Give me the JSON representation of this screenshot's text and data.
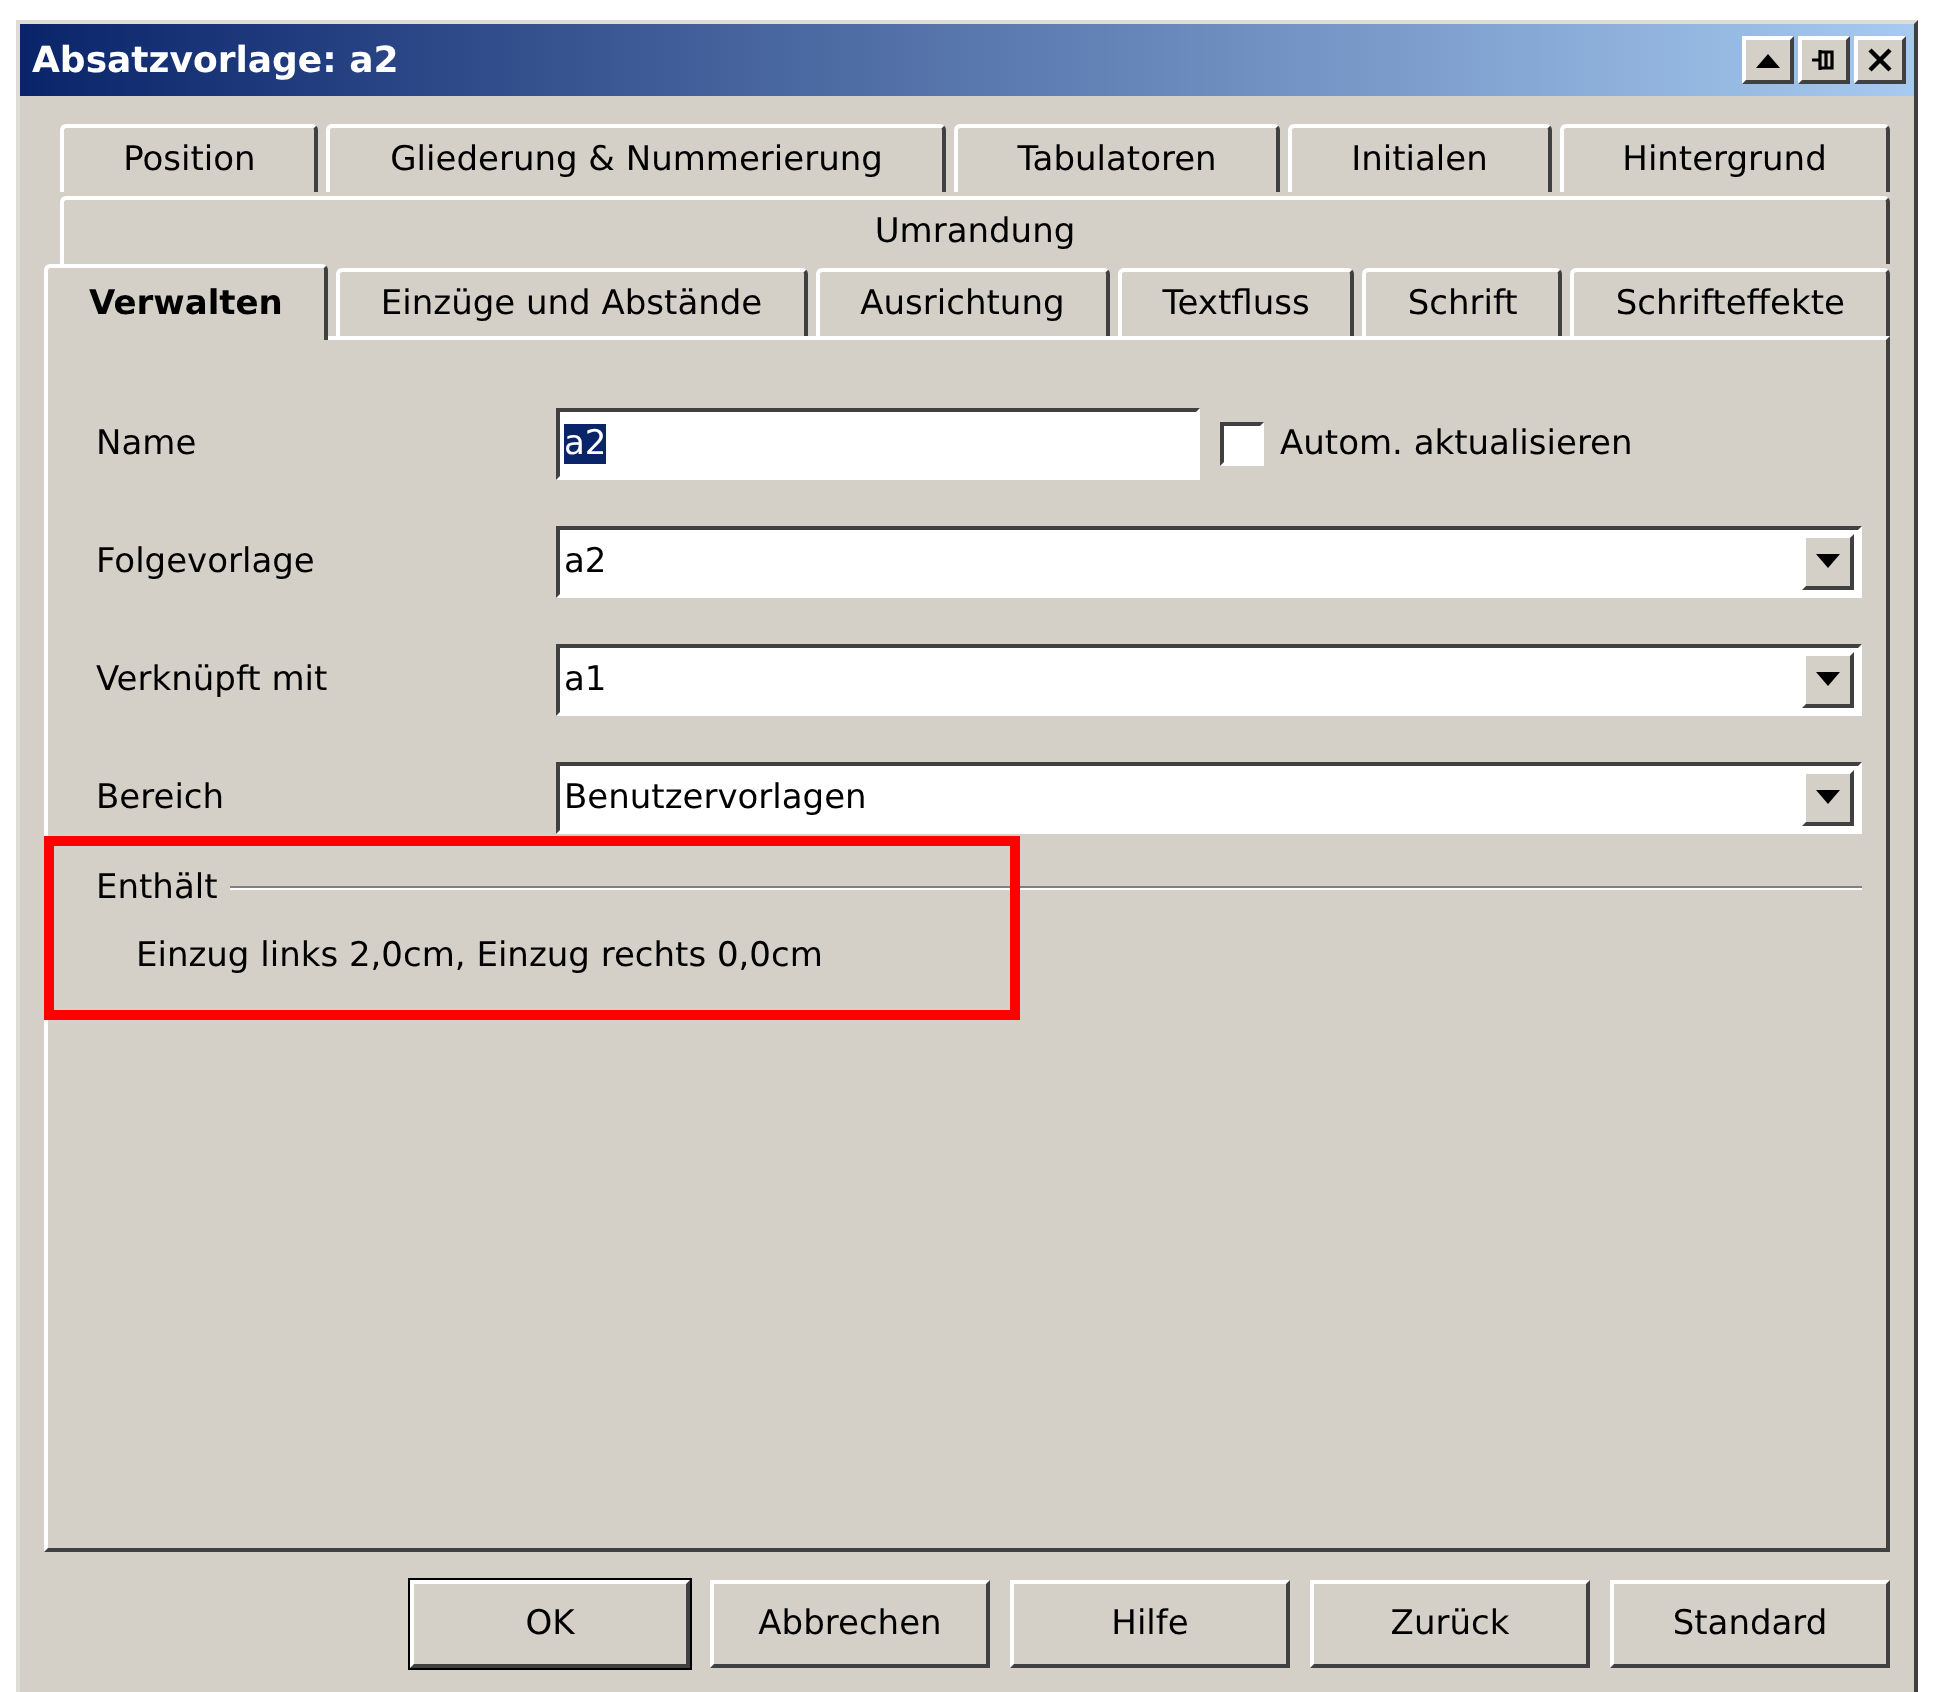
{
  "window": {
    "title": "Absatzvorlage: a2",
    "controls": [
      {
        "kind": "rollup"
      },
      {
        "kind": "pin"
      },
      {
        "kind": "close"
      }
    ]
  },
  "tab_rows": [
    [
      {
        "label": "Position",
        "selected": false
      },
      {
        "label": "Gliederung & Nummerierung",
        "selected": false
      },
      {
        "label": "Tabulatoren",
        "selected": false
      },
      {
        "label": "Initialen",
        "selected": false
      },
      {
        "label": "Hintergrund",
        "selected": false
      }
    ],
    [
      {
        "label": "Umrandung",
        "selected": false
      }
    ],
    [
      {
        "label": "Verwalten",
        "selected": true
      },
      {
        "label": "Einzüge und Abstände",
        "selected": false
      },
      {
        "label": "Ausrichtung",
        "selected": false
      },
      {
        "label": "Textfluss",
        "selected": false
      },
      {
        "label": "Schrift",
        "selected": false
      },
      {
        "label": "Schrifteffekte",
        "selected": false
      }
    ]
  ],
  "form": [
    {
      "kind": "text",
      "label": "Name",
      "value": "a2",
      "checkbox": {
        "label": "Autom. aktualisieren",
        "checked": false
      }
    },
    {
      "kind": "combo",
      "label": "Folgevorlage",
      "value": "a2"
    },
    {
      "kind": "combo",
      "label": "Verknüpft mit",
      "value": "a1"
    },
    {
      "kind": "combo",
      "label": "Bereich",
      "value": "Benutzervorlagen"
    }
  ],
  "contains": {
    "title": "Enthält",
    "text": "Einzug links 2,0cm, Einzug rechts 0,0cm"
  },
  "callout": {
    "kind": "rectangle"
  },
  "buttons": [
    {
      "label": "OK",
      "default": true
    },
    {
      "label": "Abbrechen",
      "default": false
    },
    {
      "label": "Hilfe",
      "default": false
    },
    {
      "label": "Zurück",
      "default": false
    },
    {
      "label": "Standard",
      "default": false
    }
  ]
}
